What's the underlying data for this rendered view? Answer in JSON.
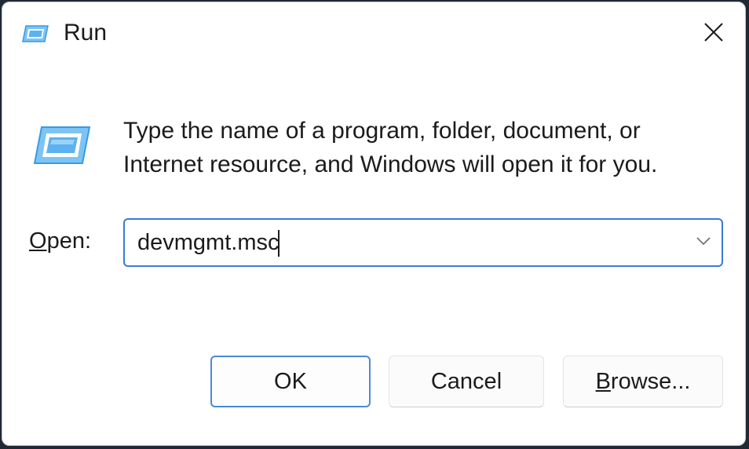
{
  "window": {
    "title": "Run",
    "title_icon": "run-icon",
    "close_icon": "close-icon"
  },
  "main": {
    "icon": "run-icon",
    "description": "Type the name of a program, folder, document, or Internet resource, and Windows will open it for you."
  },
  "open_field": {
    "label_mnemonic": "O",
    "label_rest": "pen:",
    "value": "devmgmt.msc",
    "dropdown_icon": "chevron-down-icon"
  },
  "buttons": {
    "ok_label": "OK",
    "cancel_label": "Cancel",
    "browse_mnemonic": "B",
    "browse_rest": "rowse..."
  },
  "colors": {
    "accent": "#3a7bd5",
    "icon_blue": "#3aa0e8"
  }
}
